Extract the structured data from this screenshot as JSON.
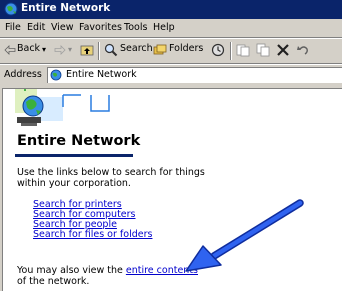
{
  "window": {
    "title": "Entire Network"
  },
  "menu": {
    "items": [
      "File",
      "Edit",
      "View",
      "Favorites",
      "Tools",
      "Help"
    ]
  },
  "toolbar": {
    "back_label": "Back",
    "search_label": "Search",
    "folders_label": "Folders"
  },
  "address": {
    "label": "Address",
    "value": "Entire Network"
  },
  "content": {
    "heading": "Entire Network",
    "intro_line1": "Use the links below to search for things",
    "intro_line2": "within your corporation.",
    "links": [
      "Search for printers",
      "Search for computers",
      "Search for people",
      "Search for files or folders"
    ],
    "footer_prefix": "You may also view the ",
    "footer_link": "entire contents",
    "footer_suffix": "of the network."
  },
  "icons": {
    "title": "globe-icon",
    "back": "back-arrow-icon",
    "forward": "forward-arrow-icon",
    "up": "up-folder-icon",
    "search": "search-icon",
    "folders": "folders-icon",
    "history": "history-icon",
    "move_to": "move-to-icon",
    "copy_to": "copy-to-icon",
    "delete": "delete-icon",
    "undo": "undo-icon",
    "annotation": "blue-arrow-annotation"
  },
  "colors": {
    "title_bar": "#0a246a",
    "link": "#0000cc",
    "annotation_arrow": "#1a3fd6"
  }
}
